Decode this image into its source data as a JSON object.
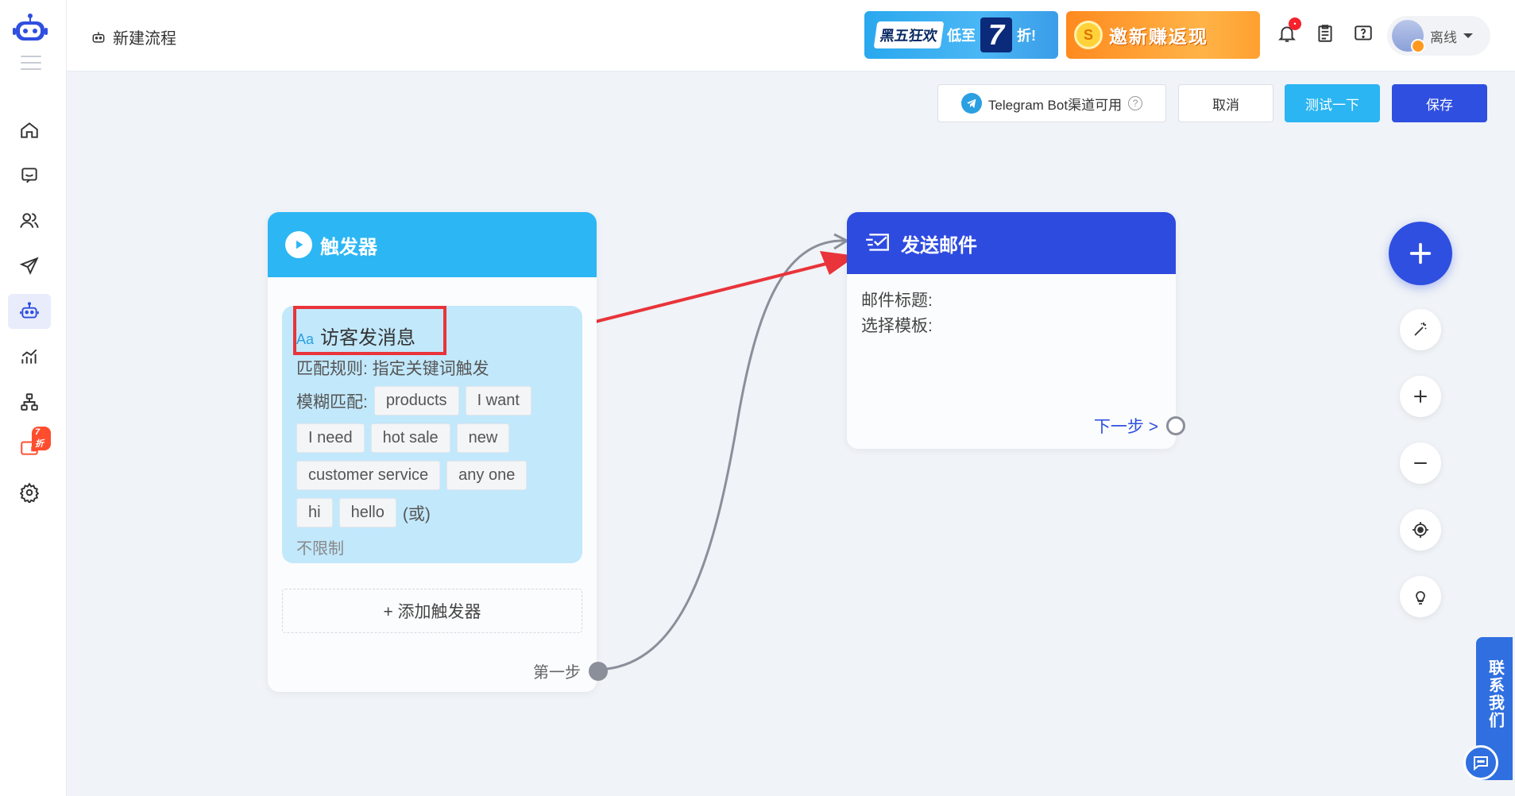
{
  "header": {
    "title": "新建流程",
    "promo1": {
      "part1": "黑五狂欢",
      "part2": "低至",
      "part3": "7",
      "part4": "折!"
    },
    "promo2": {
      "text": "邀新赚返现",
      "coin": "S"
    },
    "notification_count": "•",
    "user_status": "离线"
  },
  "sidebar": {
    "badge": "7折"
  },
  "actions": {
    "channel_label": "Telegram Bot渠道可用",
    "help_symbol": "?",
    "cancel": "取消",
    "test": "测试一下",
    "save": "保存"
  },
  "trigger_node": {
    "title": "触发器",
    "item_icon": "Aa",
    "item_title": "访客发消息",
    "match_rule": "匹配规则: 指定关键词触发",
    "fuzzy_label": "模糊匹配:",
    "keywords": [
      "products",
      "I want",
      "I need",
      "hot sale",
      "new",
      "customer service",
      "any one",
      "hi",
      "hello"
    ],
    "or_text": "(或)",
    "limit_text": "不限制",
    "add_trigger": "+ 添加触发器",
    "first_step": "第一步"
  },
  "email_node": {
    "title": "发送邮件",
    "subject_label": "邮件标题:",
    "template_label": "选择模板:",
    "next_step": "下一步 >"
  },
  "contact": {
    "label": "联系我们"
  },
  "colors": {
    "accent": "#2f4fe0",
    "trigger_head": "#2cb6f4",
    "trigger_body": "#c2e8fb",
    "test_button": "#2bb5f3",
    "annotation_red": "#e8343a"
  }
}
